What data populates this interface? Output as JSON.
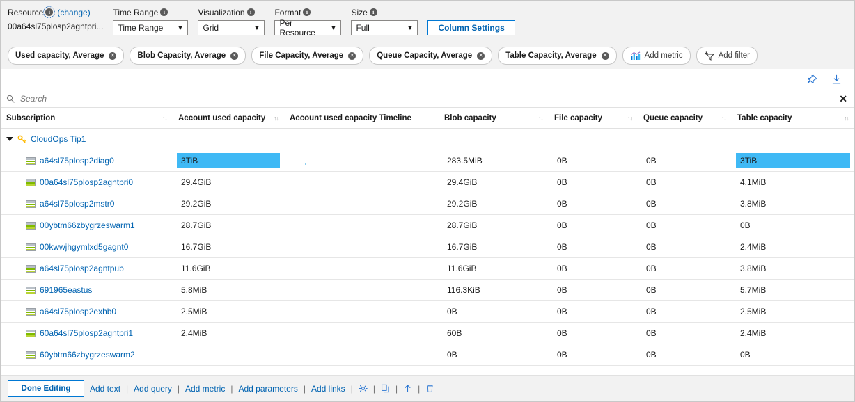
{
  "toolbar": {
    "resource": {
      "label": "Resource",
      "info_icon": "info-icon",
      "change_label": "(change)",
      "value": "00a64sl75plosp2agntpri..."
    },
    "time_range": {
      "label": "Time Range",
      "value": "Time Range"
    },
    "visualization": {
      "label": "Visualization",
      "value": "Grid"
    },
    "format": {
      "label": "Format",
      "value": "Per Resource"
    },
    "size": {
      "label": "Size",
      "value": "Full"
    },
    "column_settings_label": "Column Settings"
  },
  "pills": [
    {
      "label": "Used capacity, Average",
      "removable": true
    },
    {
      "label": "Blob Capacity, Average",
      "removable": true
    },
    {
      "label": "File Capacity, Average",
      "removable": true
    },
    {
      "label": "Queue Capacity, Average",
      "removable": true
    },
    {
      "label": "Table Capacity, Average",
      "removable": true
    },
    {
      "label": "Add metric",
      "removable": false,
      "icon": "bar-chart-icon"
    },
    {
      "label": "Add filter",
      "removable": false,
      "icon": "add-filter-icon"
    }
  ],
  "actions": {
    "pin_icon": "pin-icon",
    "download_icon": "download-icon"
  },
  "search": {
    "placeholder": "Search",
    "value": "",
    "search_icon": "search-icon",
    "clear_label": "✕"
  },
  "table": {
    "columns": [
      {
        "header": "Subscription",
        "sortable": true
      },
      {
        "header": "Account used capacity",
        "sortable": true
      },
      {
        "header": "Account used capacity Timeline",
        "sortable": false
      },
      {
        "header": "Blob capacity",
        "sortable": true
      },
      {
        "header": "File capacity",
        "sortable": true
      },
      {
        "header": "Queue capacity",
        "sortable": true
      },
      {
        "header": "Table capacity",
        "sortable": true
      }
    ],
    "sort_glyph": "↑↓",
    "group": {
      "label": "CloudOps Tip1",
      "icon": "key-icon",
      "expanded": true
    },
    "rows": [
      {
        "name": "a64sl75plosp2diag0",
        "used": "3TiB",
        "used_highlight": true,
        "timeline": "block",
        "blob": "283.5MiB",
        "file": "0B",
        "queue": "0B",
        "table": "3TiB",
        "table_highlight": true
      },
      {
        "name": "00a64sl75plosp2agntpri0",
        "used": "29.4GiB",
        "used_highlight": false,
        "timeline": "sparkline",
        "blob": "29.4GiB",
        "file": "0B",
        "queue": "0B",
        "table": "4.1MiB",
        "table_highlight": false
      },
      {
        "name": "a64sl75plosp2mstr0",
        "used": "29.2GiB",
        "used_highlight": false,
        "timeline": "sparkline",
        "blob": "29.2GiB",
        "file": "0B",
        "queue": "0B",
        "table": "3.8MiB",
        "table_highlight": false
      },
      {
        "name": "00ybtm66zbygrzeswarm1",
        "used": "28.7GiB",
        "used_highlight": false,
        "timeline": "sparkline",
        "blob": "28.7GiB",
        "file": "0B",
        "queue": "0B",
        "table": "0B",
        "table_highlight": false
      },
      {
        "name": "00kwwjhgymlxd5gagnt0",
        "used": "16.7GiB",
        "used_highlight": false,
        "timeline": "sparkline",
        "blob": "16.7GiB",
        "file": "0B",
        "queue": "0B",
        "table": "2.4MiB",
        "table_highlight": false
      },
      {
        "name": "a64sl75plosp2agntpub",
        "used": "11.6GiB",
        "used_highlight": false,
        "timeline": "sparkline",
        "blob": "11.6GiB",
        "file": "0B",
        "queue": "0B",
        "table": "3.8MiB",
        "table_highlight": false
      },
      {
        "name": "691965eastus",
        "used": "5.8MiB",
        "used_highlight": false,
        "timeline": "sparkline",
        "blob": "116.3KiB",
        "file": "0B",
        "queue": "0B",
        "table": "5.7MiB",
        "table_highlight": false
      },
      {
        "name": "a64sl75plosp2exhb0",
        "used": "2.5MiB",
        "used_highlight": false,
        "timeline": "sparkline",
        "blob": "0B",
        "file": "0B",
        "queue": "0B",
        "table": "2.5MiB",
        "table_highlight": false
      },
      {
        "name": "60a64sl75plosp2agntpri1",
        "used": "2.4MiB",
        "used_highlight": false,
        "timeline": "sparkline",
        "blob": "60B",
        "file": "0B",
        "queue": "0B",
        "table": "2.4MiB",
        "table_highlight": false
      },
      {
        "name": "60ybtm66zbygrzeswarm2",
        "used": "",
        "used_highlight": false,
        "timeline": "none",
        "blob": "0B",
        "file": "0B",
        "queue": "0B",
        "table": "0B",
        "table_highlight": false
      }
    ]
  },
  "footer": {
    "done_label": "Done Editing",
    "links": [
      "Add text",
      "Add query",
      "Add metric",
      "Add parameters",
      "Add links"
    ],
    "separator": "|",
    "icons": [
      "gear-icon",
      "copy-icon",
      "move-up-icon",
      "delete-icon"
    ]
  },
  "colors": {
    "accent": "#0078d4",
    "link": "#0063b1",
    "highlight": "#3fb9f5",
    "sparkline": "#5ec2f0",
    "timeline_block": "#b3e0f7"
  }
}
